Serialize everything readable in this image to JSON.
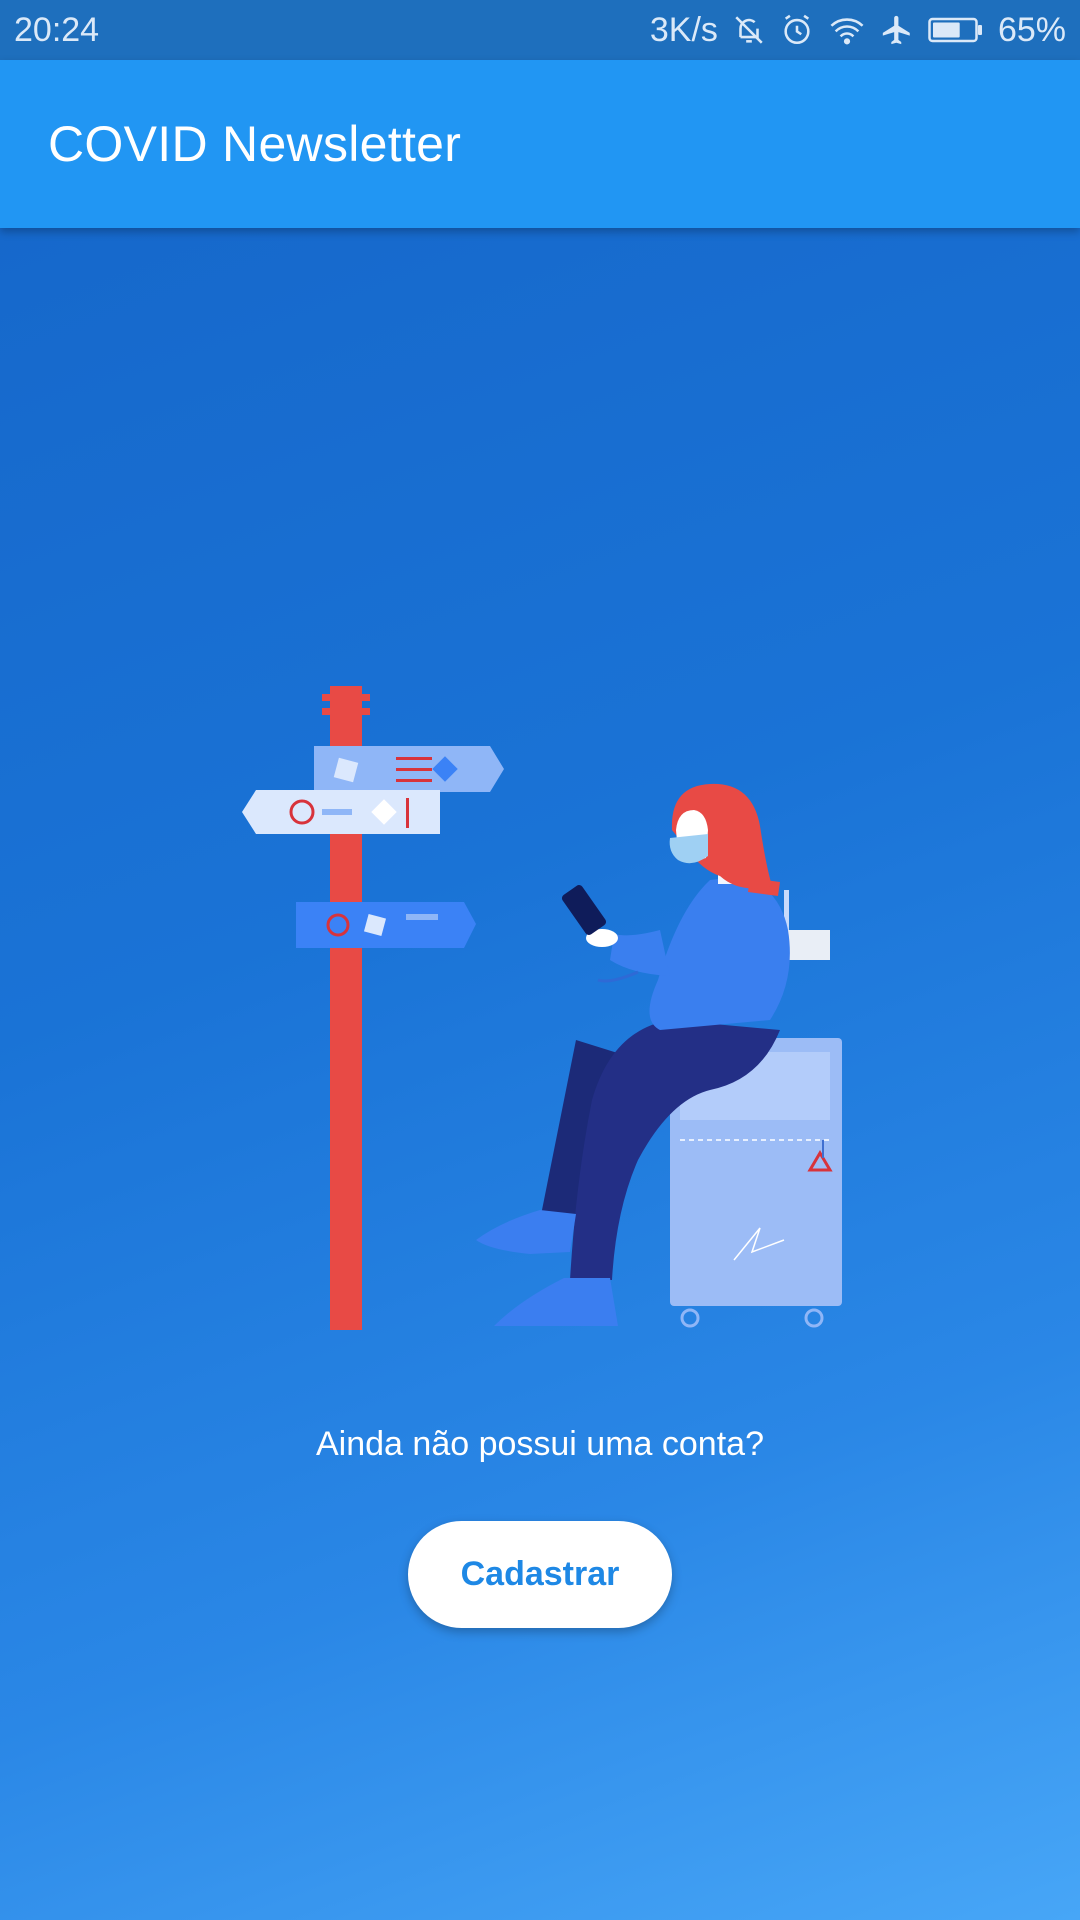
{
  "status_bar": {
    "time": "20:24",
    "network_speed": "3K/s",
    "battery_percent": "65%",
    "battery_level": 0.65,
    "icons": [
      "bell-off-icon",
      "alarm-icon",
      "wifi-icon",
      "airplane-icon",
      "battery-icon"
    ]
  },
  "app_bar": {
    "title": "COVID Newsletter"
  },
  "main": {
    "prompt": "Ainda não possui uma conta?",
    "signup_label": "Cadastrar"
  },
  "colors": {
    "app_bar": "#2196f3",
    "status_bar": "#1e6fbd",
    "background_top": "#1565c8",
    "background_bottom": "#47a6f7",
    "button_text": "#1e88e5",
    "signpost_pole": "#e84a45"
  }
}
